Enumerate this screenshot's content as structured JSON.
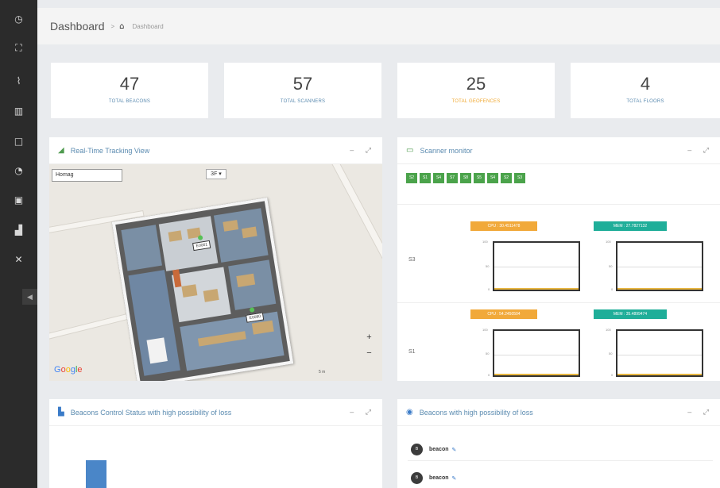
{
  "header": {
    "title": "Dashboard",
    "breadcrumb_sep": ">",
    "breadcrumb": "Dashboard"
  },
  "stats": [
    {
      "value": "47",
      "label": "TOTAL BEACONS"
    },
    {
      "value": "57",
      "label": "TOTAL SCANNERS"
    },
    {
      "value": "25",
      "label": "TOTAL GEOFENCES"
    },
    {
      "value": "4",
      "label": "TOTAL FLOORS"
    }
  ],
  "tracking": {
    "title": "Real-Time Tracking View",
    "search_placeholder": "Homag",
    "floor": "3F ▾",
    "tags": [
      "E0061",
      "E0080"
    ],
    "google": "Google",
    "scale": "5 m"
  },
  "monitor": {
    "title": "Scanner monitor",
    "chips": [
      "S2",
      "S1",
      "S4",
      "S7",
      "S8",
      "S5",
      "S4",
      "S2",
      "S3"
    ],
    "rows": [
      {
        "label": "S3",
        "cpu": "CPU : 30.4511478",
        "mem": "MEM : 27.7827132",
        "ticks": [
          "100",
          "50",
          "0"
        ]
      },
      {
        "label": "S1",
        "cpu": "CPU : 54.2450504",
        "mem": "MEM : 35.4899474",
        "ticks": [
          "100",
          "50",
          "0"
        ]
      }
    ]
  },
  "control": {
    "title": "Beacons Control Status with high possibility of loss"
  },
  "loss": {
    "title": "Beacons with high possibility of loss",
    "items": [
      {
        "avatar": "B",
        "name": "beacon"
      },
      {
        "avatar": "B",
        "name": "beacon"
      }
    ]
  },
  "colors": {
    "accent": "#5b8bb0",
    "green": "#4ba34b",
    "orange": "#f1a93a",
    "teal": "#1fae99"
  }
}
